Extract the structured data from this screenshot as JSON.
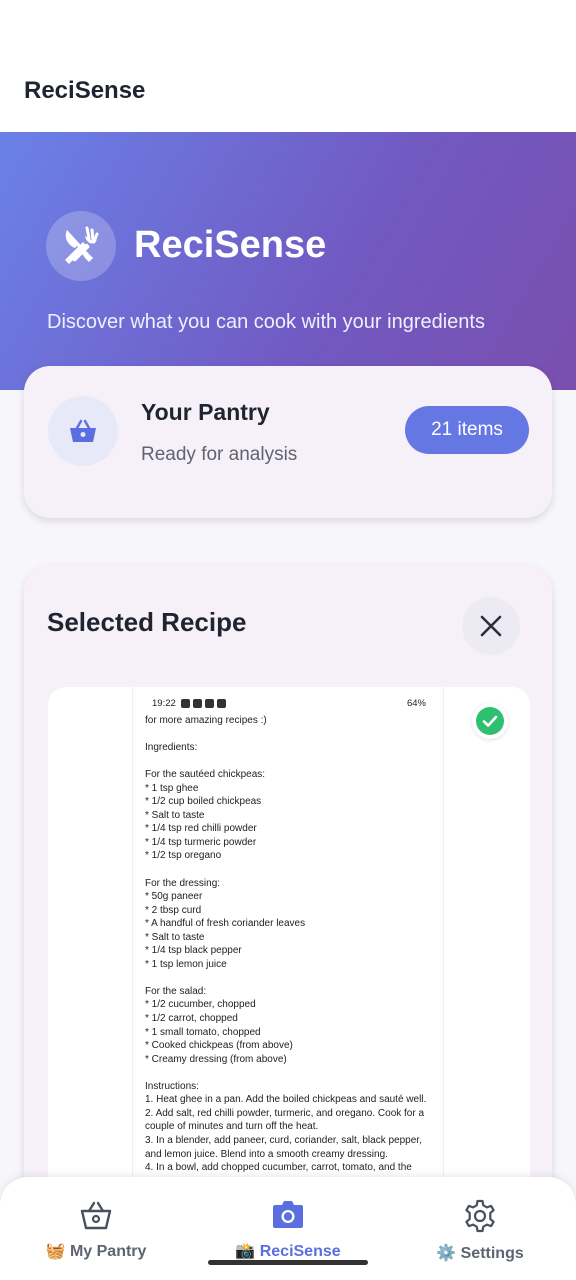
{
  "app_bar": {
    "title": "ReciSense"
  },
  "hero": {
    "title": "ReciSense",
    "subtitle": "Discover what you can cook with your ingredients",
    "logo_icon": "fork-knife-icon"
  },
  "pantry": {
    "title": "Your Pantry",
    "status": "Ready for analysis",
    "count_label": "21 items",
    "icon": "basket-icon"
  },
  "selected_recipe": {
    "title": "Selected Recipe",
    "close_icon": "close-icon",
    "check_icon": "check-circle-icon",
    "screenshot": {
      "status_time": "19:22",
      "status_battery": "64%",
      "lines": [
        "for more amazing recipes :)",
        "",
        "Ingredients:",
        "",
        "For the sautéed chickpeas:",
        "* 1 tsp ghee",
        "* 1/2 cup boiled chickpeas",
        "* Salt to taste",
        "* 1/4 tsp red chilli powder",
        "* 1/4 tsp turmeric powder",
        "* 1/2 tsp oregano",
        "",
        "For the dressing:",
        "* 50g paneer",
        "* 2 tbsp curd",
        "* A handful of fresh coriander leaves",
        "* Salt to taste",
        "* 1/4 tsp black pepper",
        "* 1 tsp lemon juice",
        "",
        "For the salad:",
        "* 1/2 cucumber, chopped",
        "* 1/2 carrot, chopped",
        "* 1 small tomato, chopped",
        "* Cooked chickpeas (from above)",
        "* Creamy dressing (from above)",
        "",
        "Instructions:",
        "1. Heat ghee in a pan. Add the boiled chickpeas and sauté well.",
        "2. Add salt, red chilli powder, turmeric, and oregano. Cook for a",
        "couple of minutes and turn off the heat.",
        "3. In a blender, add paneer, curd, coriander, salt, black pepper,",
        "and lemon juice. Blend into a smooth creamy dressing.",
        "4. In a bowl, add chopped cucumber, carrot, tomato, and the"
      ]
    }
  },
  "bottom_nav": {
    "items": [
      {
        "label": "🧺 My Pantry",
        "icon": "basket-icon",
        "active": false
      },
      {
        "label": "📸 ReciSense",
        "icon": "camera-icon",
        "active": true
      },
      {
        "label": "⚙️ Settings",
        "icon": "gear-icon",
        "active": false
      }
    ]
  },
  "colors": {
    "accent": "#6577e2",
    "hero_start": "#6a81e8",
    "hero_end": "#7a4fae",
    "success": "#2fbf71"
  }
}
